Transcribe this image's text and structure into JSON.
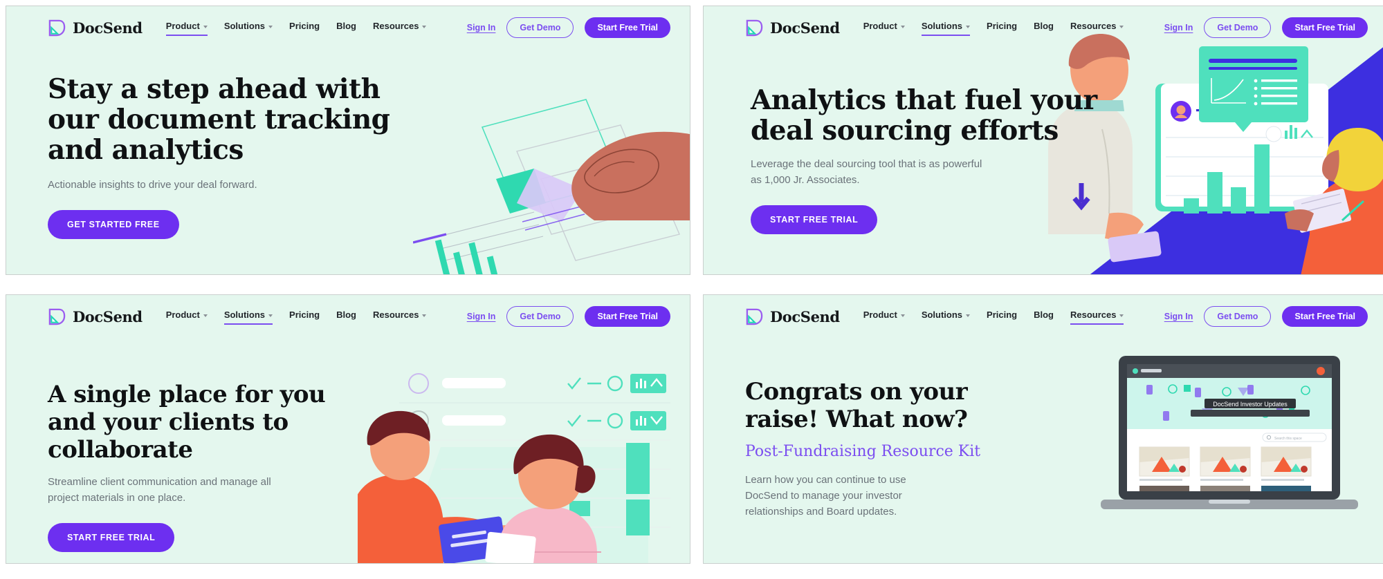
{
  "brand": {
    "name": "DocSend",
    "logo_icon": "docsend-logo-icon"
  },
  "nav": {
    "links": [
      {
        "label": "Product",
        "has_caret": true
      },
      {
        "label": "Solutions",
        "has_caret": true
      },
      {
        "label": "Pricing",
        "has_caret": false
      },
      {
        "label": "Blog",
        "has_caret": false
      },
      {
        "label": "Resources",
        "has_caret": true
      }
    ],
    "sign_in": "Sign In",
    "get_demo": "Get Demo",
    "start_free_trial": "Start Free Trial"
  },
  "colors": {
    "panel_bg": "#e4f7ee",
    "purple": "#6d2ff0",
    "purple_light": "#7b4df0",
    "teal": "#4fe0bd",
    "blue": "#3d2fe0",
    "orange": "#f4845f",
    "heading": "#0f1113",
    "body_text": "#6a7279"
  },
  "panels": [
    {
      "id": "panel-1",
      "active_nav": "Product",
      "headline": "Stay a step ahead with our document tracking and analytics",
      "subtext": "Actionable insights to drive your deal forward.",
      "cta": "GET STARTED FREE",
      "illustration": "hand-signing-document-illustration"
    },
    {
      "id": "panel-2",
      "active_nav": "Solutions",
      "headline": "Analytics that fuel your deal sourcing efforts",
      "subtext": "Leverage the deal sourcing tool that is as powerful as 1,000 Jr. Associates.",
      "cta": "START FREE TRIAL",
      "illustration": "people-with-analytics-dashboard-illustration"
    },
    {
      "id": "panel-3",
      "active_nav": "Solutions",
      "headline": "A single place for you and your clients to collaborate",
      "subtext": "Streamline client communication and manage all project materials in one place.",
      "cta": "START FREE TRIAL",
      "illustration": "two-people-collaborating-illustration"
    },
    {
      "id": "panel-4",
      "active_nav": "Resources",
      "headline": "Congrats on your raise! What now?",
      "kicker": "Post-Fundraising Resource Kit",
      "subtext": "Learn how you can continue to use DocSend to manage your investor relationships and Board updates.",
      "illustration": "laptop-investor-updates-illustration",
      "laptop_screen_title": "DocSend Investor Updates",
      "laptop_screen_brand": "DocSend",
      "laptop_search_placeholder": "Search this space"
    }
  ]
}
